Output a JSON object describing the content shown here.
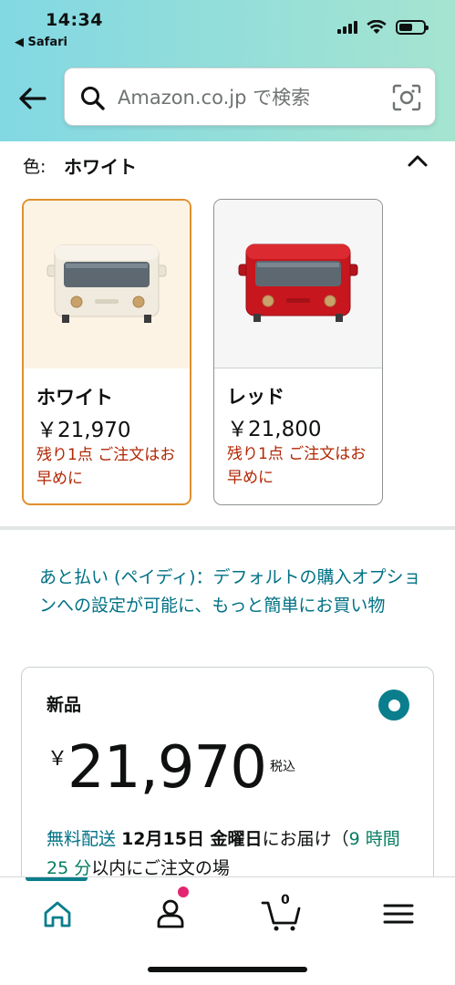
{
  "status_bar": {
    "time": "14:34",
    "back_app": "◀ Safari"
  },
  "search": {
    "placeholder": "Amazon.co.jp で検索"
  },
  "color_selector": {
    "label": "色:",
    "selected": "ホワイト"
  },
  "variants": [
    {
      "name": "ホワイト",
      "price": "￥21,970",
      "stock": "残り1点 ご注文はお早めに",
      "selected": true
    },
    {
      "name": "レッド",
      "price": "￥21,800",
      "stock": "残り1点 ご注文はお早めに",
      "selected": false
    }
  ],
  "paidy": {
    "text": "あと払い (ペイディ)：デフォルトの購入オプションへの設定が可能に、もっと簡単にお買い物"
  },
  "offer": {
    "title": "新品",
    "currency": "￥",
    "price": "21,970",
    "tax": "税込",
    "free_shipping": "無料配送",
    "delivery_date": "12月15日 金曜日",
    "delivery_suffix": "にお届け（",
    "countdown": "9 時間 25 分",
    "countdown_suffix": "以内にご注文の場"
  },
  "bottom_nav": {
    "cart_count": "0"
  },
  "colors": {
    "accent": "#007185",
    "radio": "#0a7e8c",
    "selected_border": "#e0902c",
    "stock_warning": "#b12704",
    "countdown": "#067d62"
  }
}
